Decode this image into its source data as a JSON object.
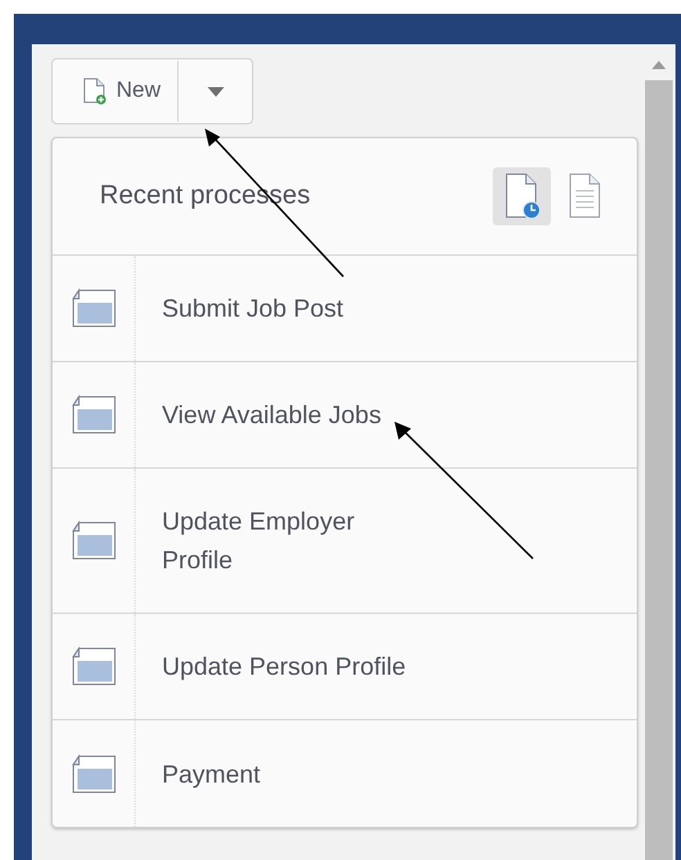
{
  "toolbar": {
    "new_button": {
      "label": "New"
    }
  },
  "recent_panel": {
    "title": "Recent processes",
    "view_toggles": [
      {
        "kind": "recent",
        "selected": true
      },
      {
        "kind": "list",
        "selected": false
      }
    ],
    "processes": [
      {
        "label": "Submit Job Post"
      },
      {
        "label": "View Available Jobs"
      },
      {
        "label": "Update Employer Profile"
      },
      {
        "label": "Update Person Profile"
      },
      {
        "label": "Payment"
      }
    ]
  }
}
